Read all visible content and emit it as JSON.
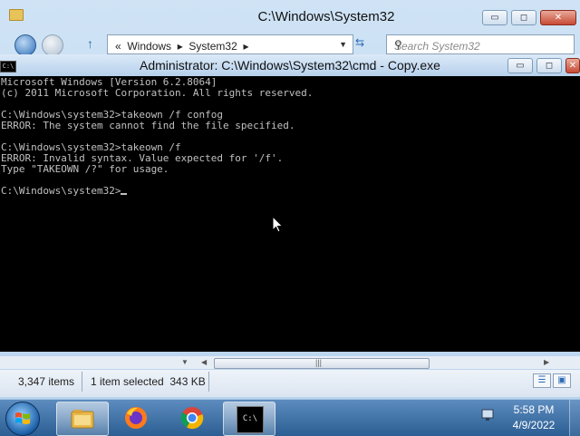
{
  "explorer": {
    "title": "C:\\Windows\\System32",
    "breadcrumb": [
      "«",
      "Windows",
      "▸",
      "System32",
      "▸"
    ],
    "search_placeholder": "Search System32",
    "status": {
      "item_count": "3,347 items",
      "selection": "1 item selected  343 KB"
    }
  },
  "cmd": {
    "title": "Administrator: C:\\Windows\\System32\\cmd - Copy.exe",
    "icon_label": "C:\\",
    "lines": [
      "Microsoft Windows [Version 6.2.8064]",
      "(c) 2011 Microsoft Corporation. All rights reserved.",
      "",
      "C:\\Windows\\system32>takeown /f confog",
      "ERROR: The system cannot find the file specified.",
      "",
      "C:\\Windows\\system32>takeown /f",
      "ERROR: Invalid syntax. Value expected for '/f'.",
      "Type \"TAKEOWN /?\" for usage.",
      "",
      "C:\\Windows\\system32>"
    ]
  },
  "window_buttons": {
    "minimize": "▭",
    "maximize": "◻",
    "close": "✕"
  },
  "taskbar": {
    "apps": [
      "explorer",
      "firefox",
      "chrome",
      "cmd"
    ],
    "cmd_label": "C:\\"
  },
  "clock": {
    "time": "5:58 PM",
    "date": "4/9/2022"
  },
  "colors": {
    "console_bg": "#000000",
    "console_text": "#c0c0c0",
    "taskbar": "#2b5e93",
    "titlebar": "#cfe3f5"
  }
}
